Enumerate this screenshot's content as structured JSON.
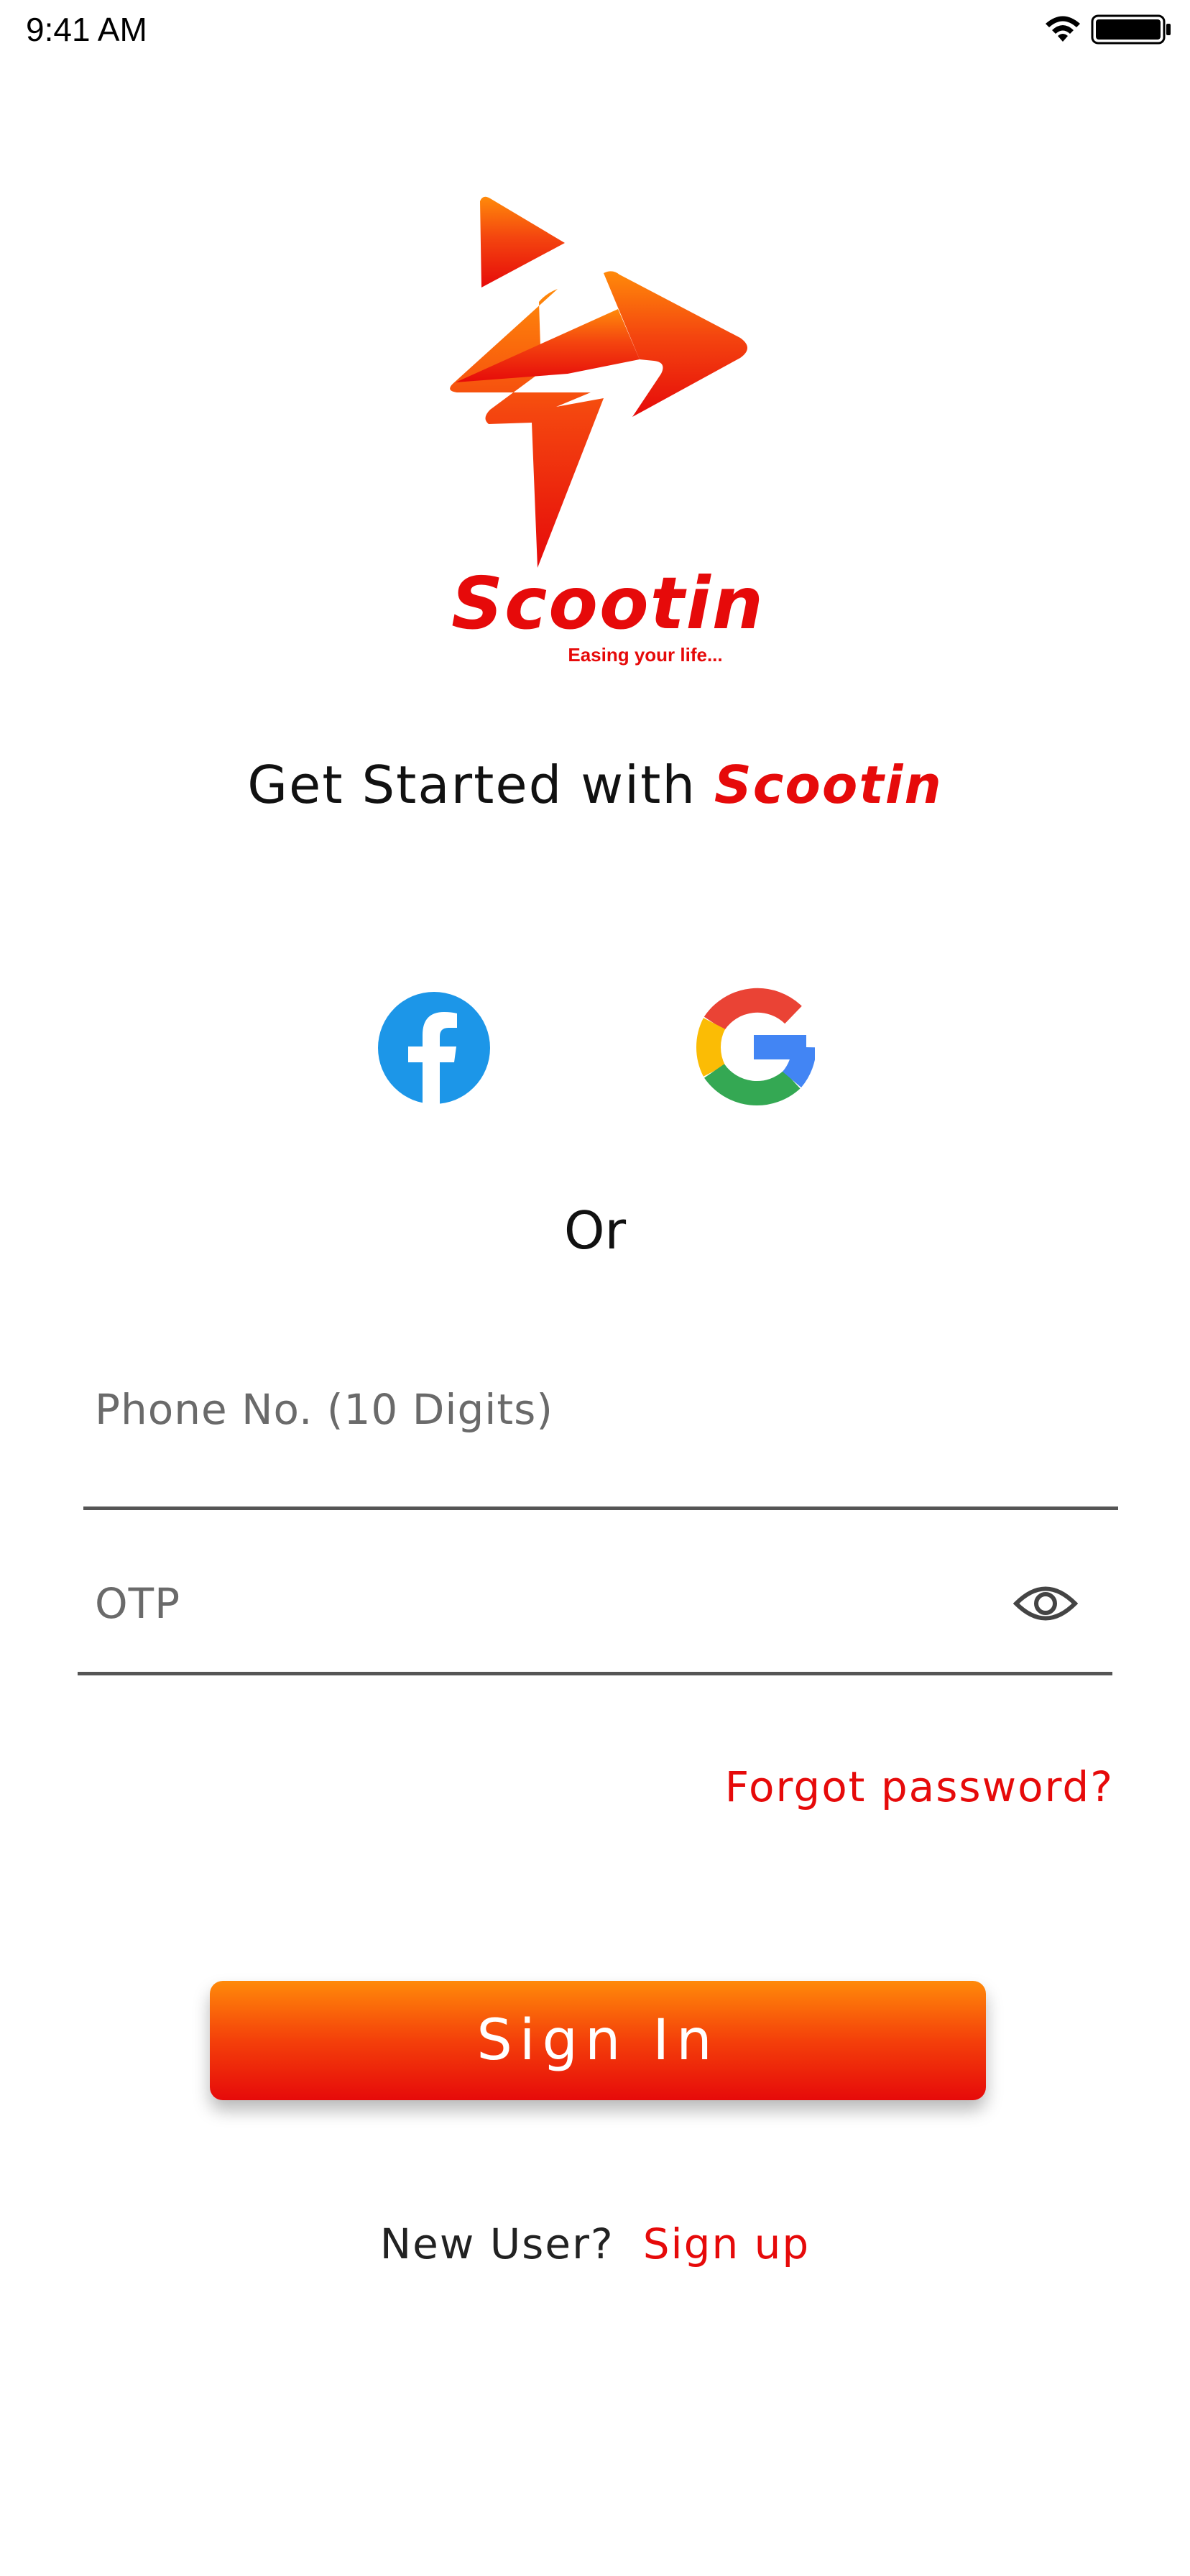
{
  "status_bar": {
    "time": "9:41 AM"
  },
  "logo": {
    "wordmark": "Scootin",
    "tagline": "Easing your life...",
    "icon": "scootin-logo-icon"
  },
  "heading": {
    "prefix": "Get Started with ",
    "brand": "Scootin"
  },
  "social": {
    "facebook_icon": "facebook-icon",
    "google_icon": "google-icon"
  },
  "divider_text": "Or",
  "form": {
    "phone_placeholder": "Phone No. (10 Digits)",
    "phone_value": "",
    "otp_placeholder": "OTP",
    "otp_value": "",
    "otp_visibility_icon": "eye-icon",
    "forgot_password": "Forgot password?"
  },
  "sign_in_label": "Sign In",
  "signup": {
    "prompt": "New User?",
    "link": "Sign up"
  },
  "colors": {
    "brand_red": "#e60a0a",
    "brand_orange": "#ff8a0a",
    "facebook_blue": "#1877f2"
  }
}
